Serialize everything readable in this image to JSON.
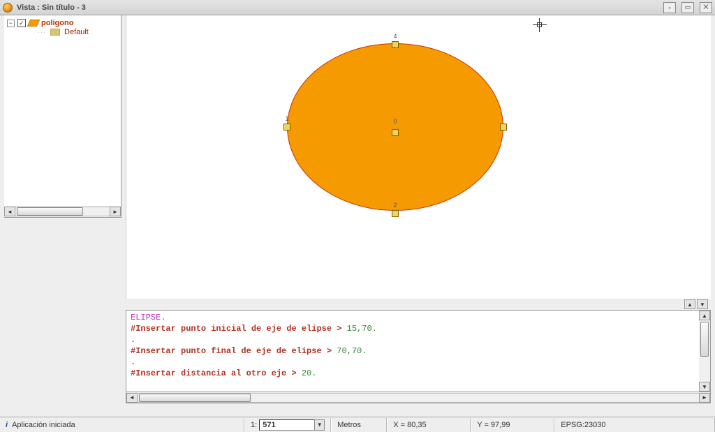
{
  "window": {
    "title": "Vista : Sin título - 3"
  },
  "toc": {
    "layer_name": "polígono",
    "default_label": "Default"
  },
  "canvas": {
    "handles": [
      "0",
      "1",
      "2",
      "4"
    ]
  },
  "console": {
    "command": "ELIPSE.",
    "lines": [
      {
        "prompt": "#Insertar punto inicial de eje de elipse >",
        "value": "15,70."
      },
      {
        "prompt": "#Insertar punto final de eje de elipse >",
        "value": "70,70."
      },
      {
        "prompt": "#Insertar distancia al otro eje >",
        "value": "20."
      }
    ]
  },
  "status": {
    "message": "Aplicación iniciada",
    "scale_prefix": "1:",
    "scale_value": "571",
    "units": "Metros",
    "x": "X = 80,35",
    "y": "Y = 97,99",
    "epsg": "EPSG:23030"
  }
}
